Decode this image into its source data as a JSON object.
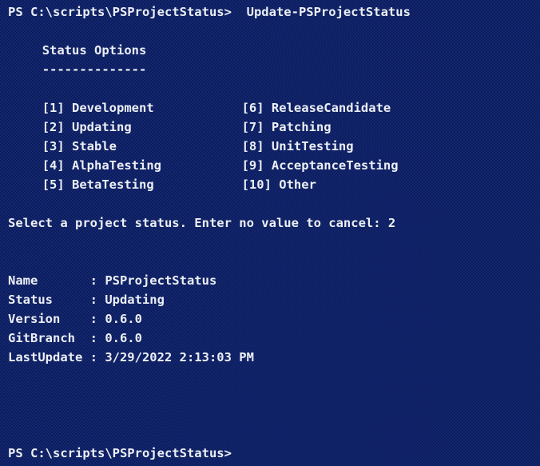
{
  "console": {
    "background_color": "#0c1d5e",
    "text_color": "#eceff4",
    "prompt_top": "PS C:\\scripts\\PSProjectStatus>  Update-PSProjectStatus",
    "prompt_bottom": "PS C:\\scripts\\PSProjectStatus>"
  },
  "menu": {
    "heading": "Status Options",
    "underline": "--------------",
    "options": [
      {
        "key": "[1]",
        "label": "Development"
      },
      {
        "key": "[2]",
        "label": "Updating"
      },
      {
        "key": "[3]",
        "label": "Stable"
      },
      {
        "key": "[4]",
        "label": "AlphaTesting"
      },
      {
        "key": "[5]",
        "label": "BetaTesting"
      },
      {
        "key": "[6]",
        "label": "ReleaseCandidate"
      },
      {
        "key": "[7]",
        "label": "Patching"
      },
      {
        "key": "[8]",
        "label": "UnitTesting"
      },
      {
        "key": "[9]",
        "label": "AcceptanceTesting"
      },
      {
        "key": "[10]",
        "label": "Other"
      }
    ],
    "option_lines": [
      {
        "left": "[1] Development",
        "right": "[6] ReleaseCandidate"
      },
      {
        "left": "[2] Updating",
        "right": "[7] Patching"
      },
      {
        "left": "[3] Stable",
        "right": "[8] UnitTesting"
      },
      {
        "left": "[4] AlphaTesting",
        "right": "[9] AcceptanceTesting"
      },
      {
        "left": "[5] BetaTesting",
        "right": "[10] Other"
      }
    ]
  },
  "input": {
    "prompt_text": "Select a project status. Enter no value to cancel: ",
    "entered_value": "2",
    "full_line": "Select a project status. Enter no value to cancel: 2"
  },
  "result": {
    "rows": [
      {
        "label": "Name",
        "separator": " : ",
        "value": "PSProjectStatus",
        "line": "Name       : PSProjectStatus"
      },
      {
        "label": "Status",
        "separator": " : ",
        "value": "Updating",
        "line": "Status     : Updating"
      },
      {
        "label": "Version",
        "separator": " : ",
        "value": "0.6.0",
        "line": "Version    : 0.6.0"
      },
      {
        "label": "GitBranch",
        "separator": " : ",
        "value": "0.6.0",
        "line": "GitBranch  : 0.6.0"
      },
      {
        "label": "LastUpdate",
        "separator": " : ",
        "value": "3/29/2022 2:13:03 PM",
        "line": "LastUpdate : 3/29/2022 2:13:03 PM"
      }
    ]
  }
}
